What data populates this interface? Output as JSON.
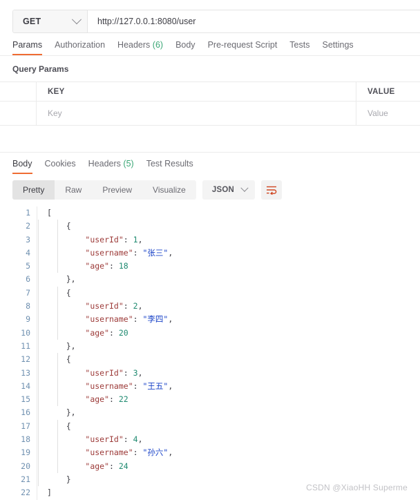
{
  "request": {
    "method": "GET",
    "method_icon": "chevron-down-icon",
    "url": "http://127.0.0.1:8080/user",
    "tabs": [
      {
        "label": "Params",
        "active": true
      },
      {
        "label": "Authorization",
        "active": false
      },
      {
        "label": "Headers",
        "count": "(6)",
        "active": false
      },
      {
        "label": "Body",
        "active": false
      },
      {
        "label": "Pre-request Script",
        "active": false
      },
      {
        "label": "Tests",
        "active": false
      },
      {
        "label": "Settings",
        "active": false
      }
    ],
    "query_params": {
      "title": "Query Params",
      "columns": [
        "KEY",
        "VALUE"
      ],
      "rows": [
        {
          "key_placeholder": "Key",
          "value_placeholder": "Value"
        }
      ]
    }
  },
  "response": {
    "tabs": [
      {
        "label": "Body",
        "active": true
      },
      {
        "label": "Cookies",
        "active": false
      },
      {
        "label": "Headers",
        "count": "(5)",
        "active": false
      },
      {
        "label": "Test Results",
        "active": false
      }
    ],
    "view_modes": [
      {
        "label": "Pretty",
        "active": true
      },
      {
        "label": "Raw",
        "active": false
      },
      {
        "label": "Preview",
        "active": false
      },
      {
        "label": "Visualize",
        "active": false
      }
    ],
    "format": {
      "selected": "JSON",
      "icon": "chevron-down-icon"
    },
    "wrap_lines_icon": "wrap-lines-icon",
    "body": {
      "language": "json",
      "line_numbers": [
        1,
        2,
        3,
        4,
        5,
        6,
        7,
        8,
        9,
        10,
        11,
        12,
        13,
        14,
        15,
        16,
        17,
        18,
        19,
        20,
        21,
        22
      ],
      "lines": [
        {
          "indent": 0,
          "tokens": [
            {
              "t": "[",
              "c": "p"
            }
          ]
        },
        {
          "indent": 1,
          "tokens": [
            {
              "t": "{",
              "c": "p"
            }
          ]
        },
        {
          "indent": 2,
          "tokens": [
            {
              "t": "\"userId\"",
              "c": "k"
            },
            {
              "t": ": ",
              "c": "p"
            },
            {
              "t": "1",
              "c": "n"
            },
            {
              "t": ",",
              "c": "p"
            }
          ]
        },
        {
          "indent": 2,
          "tokens": [
            {
              "t": "\"username\"",
              "c": "k"
            },
            {
              "t": ": ",
              "c": "p"
            },
            {
              "t": "\"张三\"",
              "c": "s"
            },
            {
              "t": ",",
              "c": "p"
            }
          ]
        },
        {
          "indent": 2,
          "tokens": [
            {
              "t": "\"age\"",
              "c": "k"
            },
            {
              "t": ": ",
              "c": "p"
            },
            {
              "t": "18",
              "c": "n"
            }
          ]
        },
        {
          "indent": 1,
          "tokens": [
            {
              "t": "},",
              "c": "p"
            }
          ]
        },
        {
          "indent": 1,
          "tokens": [
            {
              "t": "{",
              "c": "p"
            }
          ]
        },
        {
          "indent": 2,
          "tokens": [
            {
              "t": "\"userId\"",
              "c": "k"
            },
            {
              "t": ": ",
              "c": "p"
            },
            {
              "t": "2",
              "c": "n"
            },
            {
              "t": ",",
              "c": "p"
            }
          ]
        },
        {
          "indent": 2,
          "tokens": [
            {
              "t": "\"username\"",
              "c": "k"
            },
            {
              "t": ": ",
              "c": "p"
            },
            {
              "t": "\"李四\"",
              "c": "s"
            },
            {
              "t": ",",
              "c": "p"
            }
          ]
        },
        {
          "indent": 2,
          "tokens": [
            {
              "t": "\"age\"",
              "c": "k"
            },
            {
              "t": ": ",
              "c": "p"
            },
            {
              "t": "20",
              "c": "n"
            }
          ]
        },
        {
          "indent": 1,
          "tokens": [
            {
              "t": "},",
              "c": "p"
            }
          ]
        },
        {
          "indent": 1,
          "tokens": [
            {
              "t": "{",
              "c": "p"
            }
          ]
        },
        {
          "indent": 2,
          "tokens": [
            {
              "t": "\"userId\"",
              "c": "k"
            },
            {
              "t": ": ",
              "c": "p"
            },
            {
              "t": "3",
              "c": "n"
            },
            {
              "t": ",",
              "c": "p"
            }
          ]
        },
        {
          "indent": 2,
          "tokens": [
            {
              "t": "\"username\"",
              "c": "k"
            },
            {
              "t": ": ",
              "c": "p"
            },
            {
              "t": "\"王五\"",
              "c": "s"
            },
            {
              "t": ",",
              "c": "p"
            }
          ]
        },
        {
          "indent": 2,
          "tokens": [
            {
              "t": "\"age\"",
              "c": "k"
            },
            {
              "t": ": ",
              "c": "p"
            },
            {
              "t": "22",
              "c": "n"
            }
          ]
        },
        {
          "indent": 1,
          "tokens": [
            {
              "t": "},",
              "c": "p"
            }
          ]
        },
        {
          "indent": 1,
          "tokens": [
            {
              "t": "{",
              "c": "p"
            }
          ]
        },
        {
          "indent": 2,
          "tokens": [
            {
              "t": "\"userId\"",
              "c": "k"
            },
            {
              "t": ": ",
              "c": "p"
            },
            {
              "t": "4",
              "c": "n"
            },
            {
              "t": ",",
              "c": "p"
            }
          ]
        },
        {
          "indent": 2,
          "tokens": [
            {
              "t": "\"username\"",
              "c": "k"
            },
            {
              "t": ": ",
              "c": "p"
            },
            {
              "t": "\"孙六\"",
              "c": "s"
            },
            {
              "t": ",",
              "c": "p"
            }
          ]
        },
        {
          "indent": 2,
          "tokens": [
            {
              "t": "\"age\"",
              "c": "k"
            },
            {
              "t": ": ",
              "c": "p"
            },
            {
              "t": "24",
              "c": "n"
            }
          ]
        },
        {
          "indent": 1,
          "tokens": [
            {
              "t": "}",
              "c": "p"
            }
          ]
        },
        {
          "indent": 0,
          "tokens": [
            {
              "t": "]",
              "c": "p"
            }
          ]
        }
      ],
      "parsed_users": [
        {
          "userId": 1,
          "username": "张三",
          "age": 18
        },
        {
          "userId": 2,
          "username": "李四",
          "age": 20
        },
        {
          "userId": 3,
          "username": "王五",
          "age": 22
        },
        {
          "userId": 4,
          "username": "孙六",
          "age": 24
        }
      ]
    }
  },
  "watermark": "CSDN @XiaoHH Superme",
  "colors": {
    "accent": "#ef6c33",
    "count_green": "#3ba776",
    "json_key": "#9c3a38",
    "json_string": "#1b44c8",
    "json_number": "#1f8a70",
    "line_number": "#6f90b0",
    "border": "#ebebeb"
  }
}
